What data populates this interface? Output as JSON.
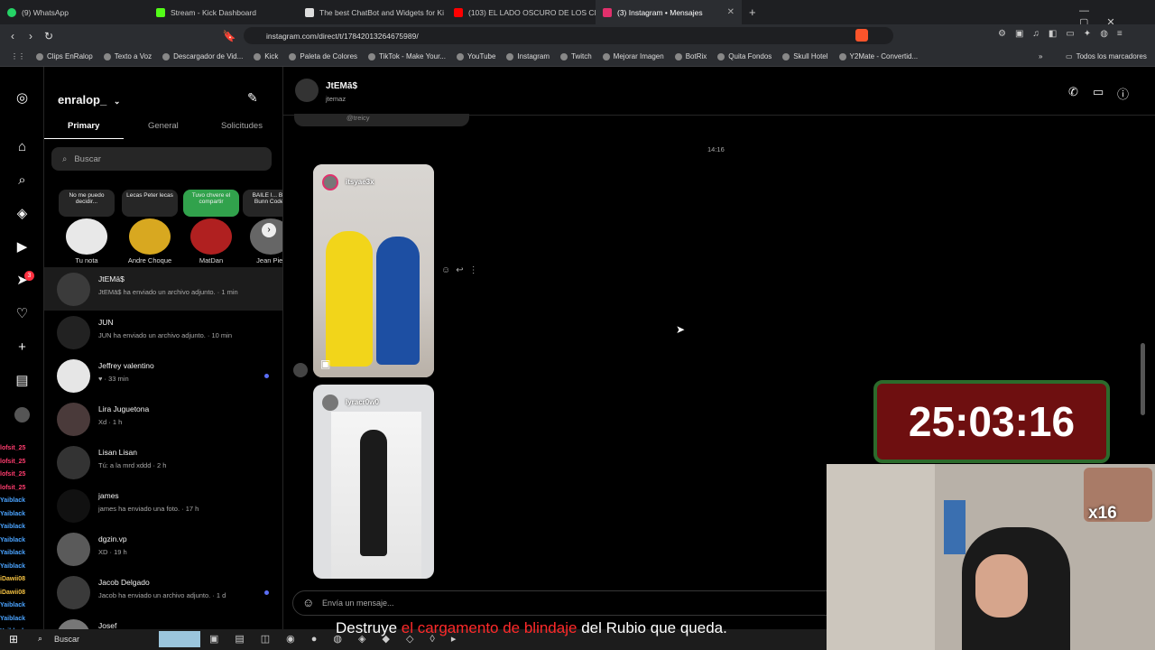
{
  "tabs": [
    {
      "label": "(9) WhatsApp",
      "color": "#25d366"
    },
    {
      "label": "Stream - Kick Dashboard",
      "color": "#53fc18"
    },
    {
      "label": "The best ChatBot and Widgets for Ki",
      "color": "#dddddd"
    },
    {
      "label": "(103) EL LADO OSCURO DE LOS CIN",
      "color": "#ff0000"
    },
    {
      "label": "(3) Instagram • Mensajes",
      "color": "#e1306c"
    }
  ],
  "url": "instagram.com/direct/t/17842013264675989/",
  "bookmarks": [
    "Clips EnRalop",
    "Texto a Voz",
    "Descargador de Vid...",
    "Kick",
    "Paleta de Colores",
    "TikTok - Make Your...",
    "YouTube",
    "Instagram",
    "Twitch",
    "Mejorar Imagen",
    "BotRix",
    "Quita Fondos",
    "Skull Hotel",
    "Y2Mate - Convertid..."
  ],
  "bookmarks_all": "Todos los marcadores",
  "rail_badge": "3",
  "inbox": {
    "username": "enralop_",
    "tabs": [
      "Primary",
      "General",
      "Solicitudes"
    ],
    "search_placeholder": "Buscar",
    "notes": [
      {
        "bubble": "No me puedo decidir...",
        "name": "Tu nota"
      },
      {
        "bubble": "Lecas Peter lecas",
        "name": "Andre Choque"
      },
      {
        "bubble": "Tuvo chvere el compartir",
        "name": "MatDan"
      },
      {
        "bubble": "BAILE I... Bad Bunn Code?",
        "name": "Jean Pier"
      }
    ],
    "threads": [
      {
        "name": "JtEMā$",
        "preview": "JtEMā$ ha enviado un archivo adjunto. · 1 min",
        "unread": false
      },
      {
        "name": "JUN",
        "preview": "JUN ha enviado un archivo adjunto. · 10 min",
        "unread": false
      },
      {
        "name": "Jeffrey valentino",
        "preview": "♥ · 33 min",
        "unread": true
      },
      {
        "name": "Lira Juguetona",
        "preview": "Xd · 1 h",
        "unread": false
      },
      {
        "name": "Lisan Lisan",
        "preview": "Tú: a la mrd xddd · 2 h",
        "unread": false
      },
      {
        "name": "james",
        "preview": "james ha enviado una foto. · 17 h",
        "unread": false
      },
      {
        "name": "dgzin.vp",
        "preview": "XD · 19 h",
        "unread": false
      },
      {
        "name": "Jacob Delgado",
        "preview": "Jacob ha enviado un archivo adjunto. · 1 d",
        "unread": true
      },
      {
        "name": "Josef",
        "preview": "",
        "unread": false
      }
    ]
  },
  "chat": {
    "name": "JtEMā$",
    "handle": "jtemaz",
    "top_partial": "@treicy",
    "time": "14:16",
    "reels": [
      {
        "author": "itsyae3x"
      },
      {
        "author": "lyracr0w0"
      }
    ],
    "composer_placeholder": "Envía un mensaje..."
  },
  "overlay": {
    "timer": "25:03:16",
    "multiplier": "x16",
    "subtitle_a": "Destruye",
    "subtitle_b": "el cargamento de blindaje",
    "subtitle_c": "del Rubio que queda.",
    "chat_users": [
      "lofsit_25",
      "lofsit_25",
      "lofsit_25",
      "lofsit_25",
      "Yaiblack",
      "Yaiblack",
      "Yaiblack",
      "Yaiblack",
      "Yaiblack",
      "Yaiblack",
      "iDawii08",
      "iDawii08",
      "Yaiblack",
      "Yaiblack",
      "Yaiblack"
    ],
    "taskbar_search": "Buscar"
  }
}
